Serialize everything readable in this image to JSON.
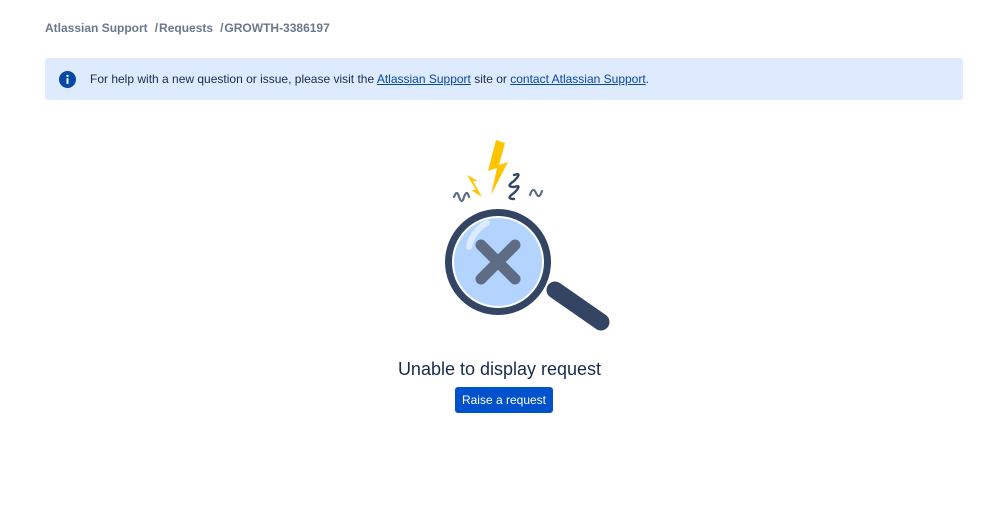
{
  "breadcrumb": {
    "items": [
      {
        "label": "Atlassian Support"
      },
      {
        "label": "Requests"
      },
      {
        "label": "GROWTH-3386197"
      }
    ],
    "separator": "/"
  },
  "banner": {
    "icon": "info-icon",
    "text_before": "For help with a new question or issue, please visit the ",
    "link1": "Atlassian Support",
    "text_middle": " site or ",
    "link2": "contact Atlassian Support",
    "text_after": "."
  },
  "illustration": {
    "icon": "magnifier-error-icon"
  },
  "error": {
    "title": "Unable to display request"
  },
  "actions": {
    "raise_label": "Raise a request"
  },
  "colors": {
    "banner_bg": "#deebff",
    "primary": "#0052cc",
    "link": "#0747a6",
    "text": "#172b4d",
    "breadcrumb": "#6b778c",
    "bolt": "#ffc400"
  }
}
